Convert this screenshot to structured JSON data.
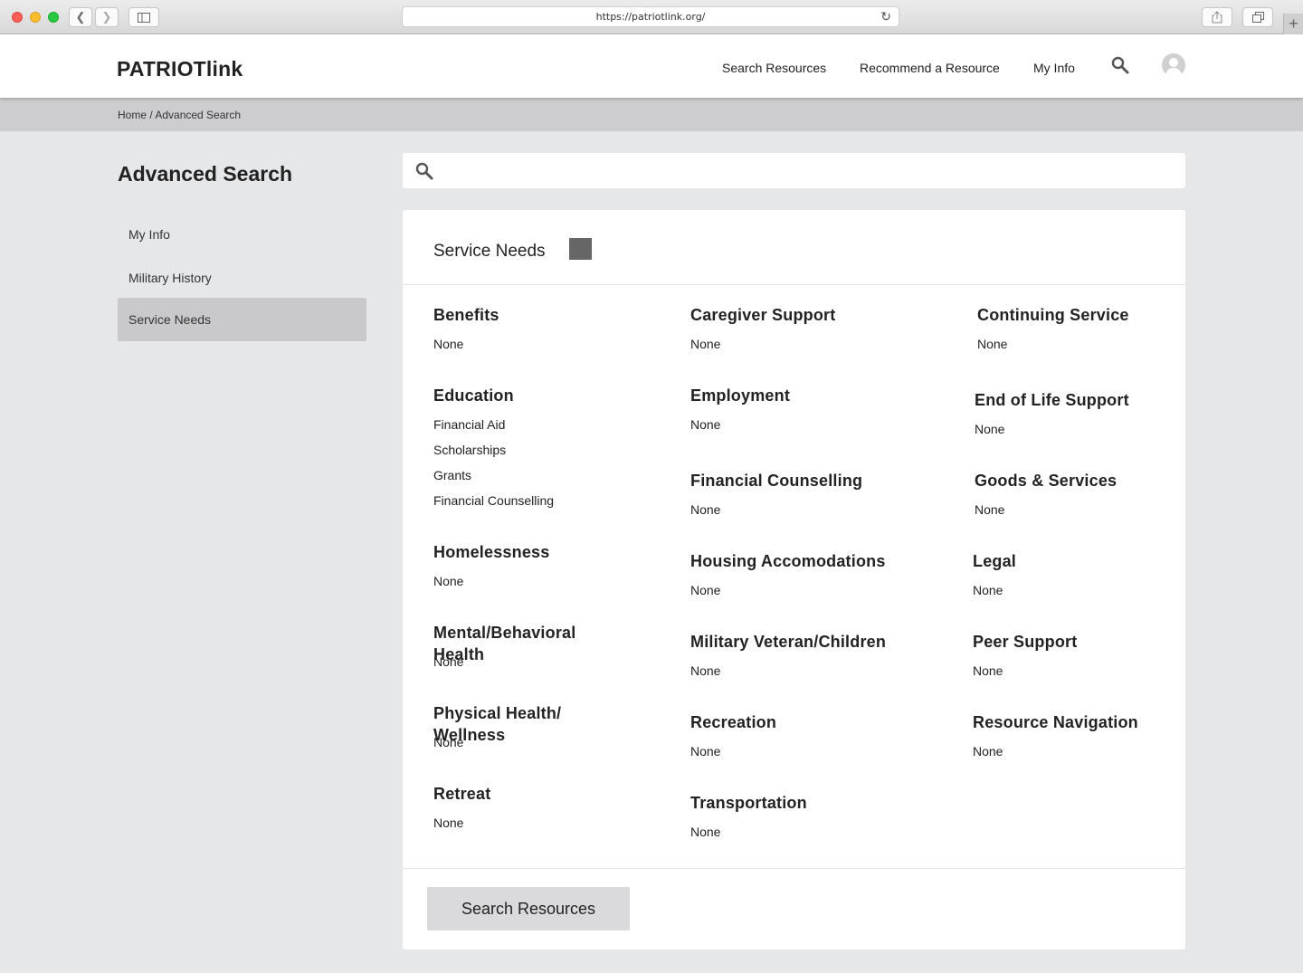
{
  "browser": {
    "url": "https://patriotlink.org/"
  },
  "header": {
    "logo": "PATRIOTlink",
    "nav": [
      "Search Resources",
      "Recommend a Resource",
      "My Info"
    ]
  },
  "breadcrumb": "Home / Advanced Search",
  "sidebar": {
    "title": "Advanced Search",
    "items": [
      {
        "label": "My Info",
        "active": false
      },
      {
        "label": "Military History",
        "active": false
      },
      {
        "label": "Service Needs",
        "active": true
      }
    ]
  },
  "search": {
    "value": "",
    "placeholder": ""
  },
  "panel": {
    "title": "Service Needs",
    "categories": [
      {
        "title": "Benefits",
        "items": [
          "None"
        ]
      },
      {
        "title": "Caregiver Support",
        "items": [
          "None"
        ]
      },
      {
        "title": "Continuing Service",
        "items": [
          "None"
        ]
      },
      {
        "title": "Education",
        "items": [
          "Financial Aid",
          "Scholarships",
          "Grants",
          "Financial Counselling"
        ]
      },
      {
        "title": "Employment",
        "items": [
          "None"
        ]
      },
      {
        "title": "End of Life Support",
        "items": [
          "None"
        ]
      },
      {
        "title": "Financial Counselling",
        "items": [
          "None"
        ]
      },
      {
        "title": "Goods & Services",
        "items": [
          "None"
        ]
      },
      {
        "title": "Homelessness",
        "items": [
          "None"
        ]
      },
      {
        "title": "Housing Accomodations",
        "items": [
          "None"
        ]
      },
      {
        "title": "Legal",
        "items": [
          "None"
        ]
      },
      {
        "title": "Mental/Behavioral Health",
        "items": [
          "None"
        ]
      },
      {
        "title": "Military Veteran/Children",
        "items": [
          "None"
        ]
      },
      {
        "title": "Peer Support",
        "items": [
          "None"
        ]
      },
      {
        "title": "Physical Health/ Wellness",
        "items": [
          "None"
        ]
      },
      {
        "title": "Recreation",
        "items": [
          "None"
        ]
      },
      {
        "title": "Resource Navigation",
        "items": [
          "None"
        ]
      },
      {
        "title": "Retreat",
        "items": [
          "None"
        ]
      },
      {
        "title": "Transportation",
        "items": [
          "None"
        ]
      }
    ],
    "button": "Search Resources"
  },
  "colors": {
    "page_bg": "#e6e7e9",
    "active_item": "#c9c9cb",
    "toggle": "#666666",
    "button": "#dadadc"
  },
  "icons": [
    "back-icon",
    "forward-icon",
    "sidebar-icon",
    "reload-icon",
    "share-icon",
    "tabs-icon",
    "new-tab-icon",
    "search-icon",
    "user-avatar-icon"
  ]
}
